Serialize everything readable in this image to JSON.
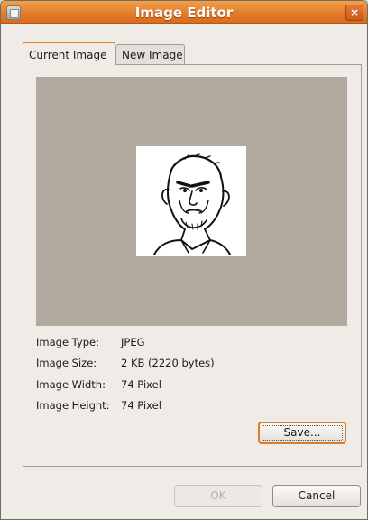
{
  "window": {
    "title": "Image Editor",
    "close_glyph": "×"
  },
  "tabs": [
    {
      "label": "Current Image",
      "active": true
    },
    {
      "label": "New Image",
      "active": false
    }
  ],
  "preview": {
    "background_color": "#b2a99f",
    "image_content": "sketch of a grumpy face"
  },
  "info": {
    "type_label": "Image Type:",
    "type_value": "JPEG",
    "size_label": "Image Size:",
    "size_value": "2 KB (2220 bytes)",
    "width_label": "Image Width:",
    "width_value": "74 Pixel",
    "height_label": "Image Height:",
    "height_value": "74 Pixel"
  },
  "buttons": {
    "save": "Save...",
    "ok": "OK",
    "cancel": "Cancel"
  },
  "colors": {
    "titlebar": "#e57b2a",
    "accent": "#e07a2c"
  }
}
